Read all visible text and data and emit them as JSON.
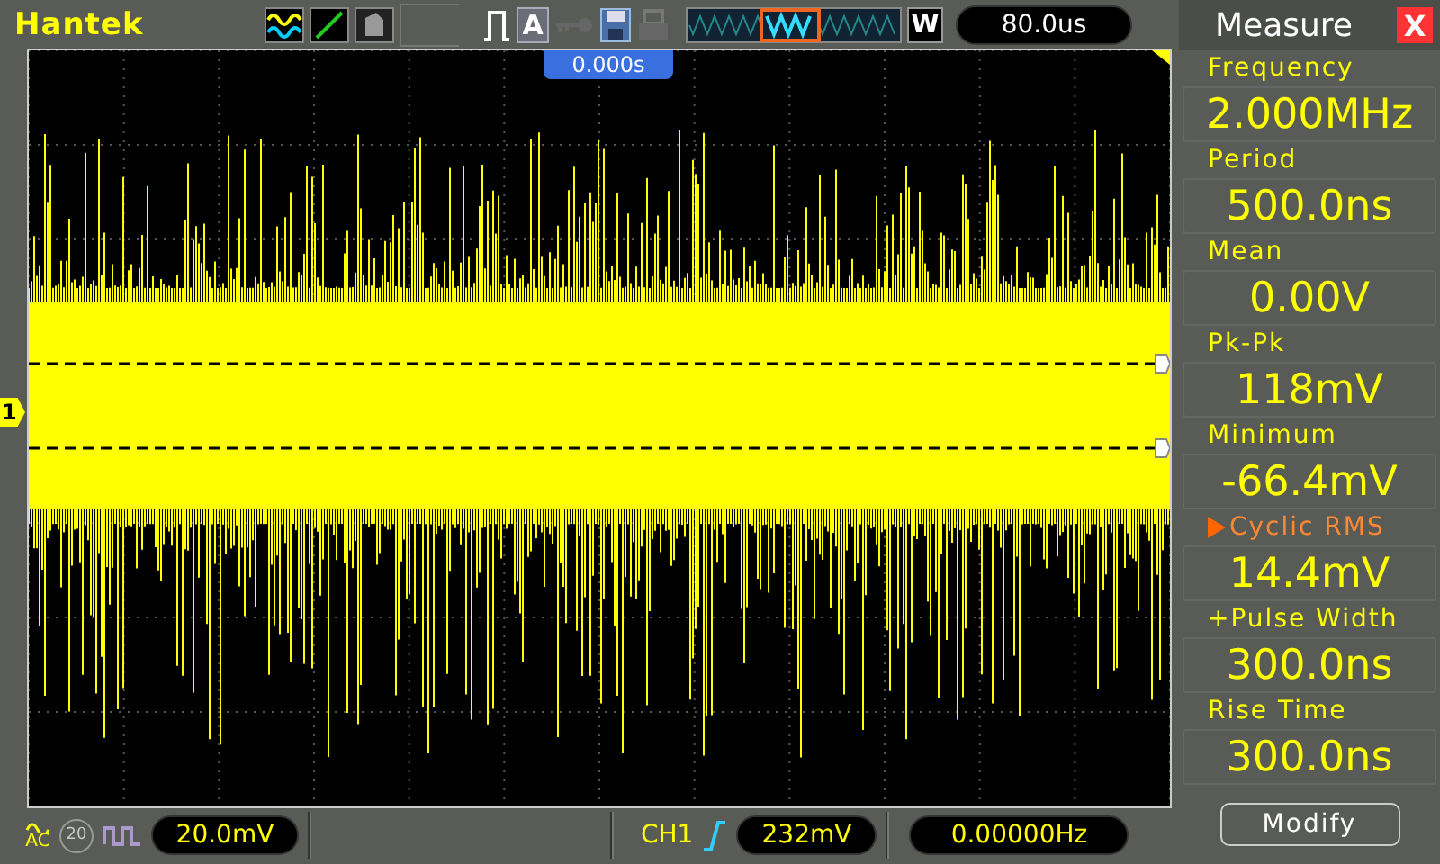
{
  "brand": "Hantek",
  "top_bar": {
    "auto_label": "A",
    "window_label": "W",
    "timebase": "80.0us"
  },
  "screen": {
    "trigger_position": "0.000s",
    "channel_marker": "1"
  },
  "measure": {
    "title": "Measure",
    "close": "X",
    "button": "Modify",
    "items": [
      {
        "label": "Frequency",
        "value": "2.000MHz",
        "selected": false
      },
      {
        "label": "Period",
        "value": "500.0ns",
        "selected": false
      },
      {
        "label": "Mean",
        "value": "0.00V",
        "selected": false
      },
      {
        "label": "Pk-Pk",
        "value": "118mV",
        "selected": false
      },
      {
        "label": "Minimum",
        "value": "-66.4mV",
        "selected": false
      },
      {
        "label": "Cyclic RMS",
        "value": "14.4mV",
        "selected": true
      },
      {
        "label": "+Pulse Width",
        "value": "300.0ns",
        "selected": false
      },
      {
        "label": "Rise Time",
        "value": "300.0ns",
        "selected": false
      }
    ]
  },
  "bottom_bar": {
    "coupling": "AC",
    "bandwidth_limit": {
      "label": "20",
      "on": false
    },
    "volts_div": "20.0mV",
    "trigger_source": "CH1",
    "trigger_level": "232mV",
    "frequency": "0.00000Hz"
  }
}
